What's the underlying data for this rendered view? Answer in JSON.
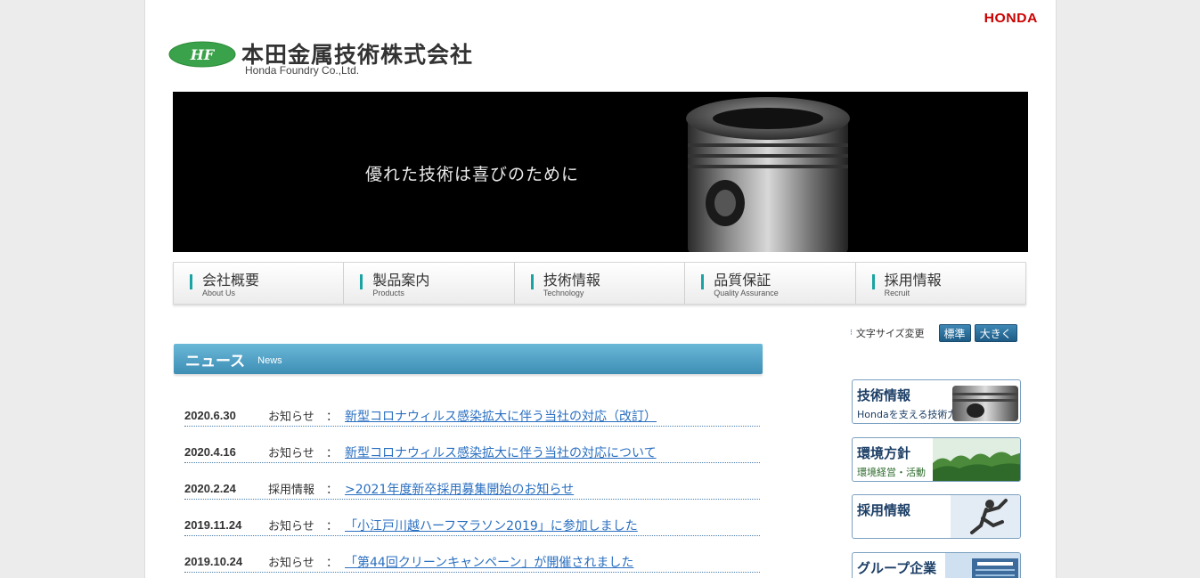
{
  "header": {
    "honda_logo": "HONDA",
    "company_name": "本田金属技術株式会社",
    "company_name_en": "Honda Foundry Co.,Ltd."
  },
  "hero": {
    "tagline": "優れた技術は喜びのために"
  },
  "nav": {
    "items": [
      {
        "jp": "会社概要",
        "en": "About Us"
      },
      {
        "jp": "製品案内",
        "en": "Products"
      },
      {
        "jp": "技術情報",
        "en": "Technology"
      },
      {
        "jp": "品質保証",
        "en": "Quality Assurance"
      },
      {
        "jp": "採用情報",
        "en": "Recruit"
      }
    ]
  },
  "font_size": {
    "label": "文字サイズ変更",
    "standard": "標準",
    "large": "大きく"
  },
  "news": {
    "title": "ニュース",
    "subtitle": "News",
    "separator": "：",
    "items": [
      {
        "date": "2020.6.30",
        "category": "お知らせ",
        "title": "新型コロナウィルス感染拡大に伴う当社の対応（改訂）"
      },
      {
        "date": "2020.4.16",
        "category": "お知らせ",
        "title": "新型コロナウィルス感染拡大に伴う当社の対応について"
      },
      {
        "date": "2020.2.24",
        "category": "採用情報",
        "title": ">2021年度新卒採用募集開始のお知らせ"
      },
      {
        "date": "2019.11.24",
        "category": "お知らせ",
        "title": "「小江戸川越ハーフマラソン2019」に参加しました"
      },
      {
        "date": "2019.10.24",
        "category": "お知らせ",
        "title": "「第44回クリーンキャンペーン」が開催されました"
      }
    ]
  },
  "side_banners": {
    "tech": {
      "title": "技術情報",
      "sub": "Hondaを支える技術力"
    },
    "env": {
      "title": "環境方針",
      "sub": "環境経営・活動"
    },
    "recruit": {
      "title": "採用情報"
    },
    "group": {
      "title": "グループ企業"
    }
  },
  "colors": {
    "accent_teal": "#1aa3a3",
    "news_header": "#4a9ec4",
    "link": "#2a6fc0",
    "honda_red": "#cc0000"
  }
}
